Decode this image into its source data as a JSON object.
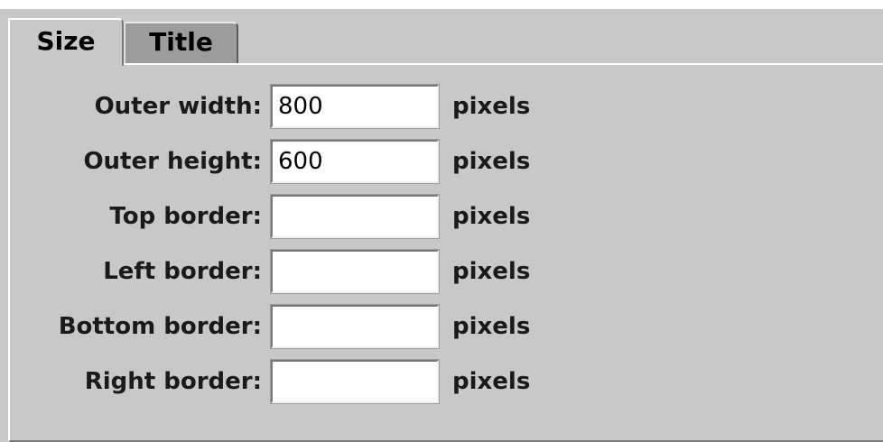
{
  "tabs": [
    {
      "label": "Size",
      "selected": true
    },
    {
      "label": "Title",
      "selected": false
    }
  ],
  "fields": [
    {
      "label": "Outer width:",
      "value": "800",
      "unit": "pixels"
    },
    {
      "label": "Outer height:",
      "value": "600",
      "unit": "pixels"
    },
    {
      "label": "Top border:",
      "value": "",
      "unit": "pixels"
    },
    {
      "label": "Left border:",
      "value": "",
      "unit": "pixels"
    },
    {
      "label": "Bottom border:",
      "value": "",
      "unit": "pixels"
    },
    {
      "label": "Right border:",
      "value": "",
      "unit": "pixels"
    }
  ],
  "colors": {
    "panel": "#c8c8c8",
    "inactive_tab": "#9c9c9c",
    "field_bg": "#ffffff"
  }
}
